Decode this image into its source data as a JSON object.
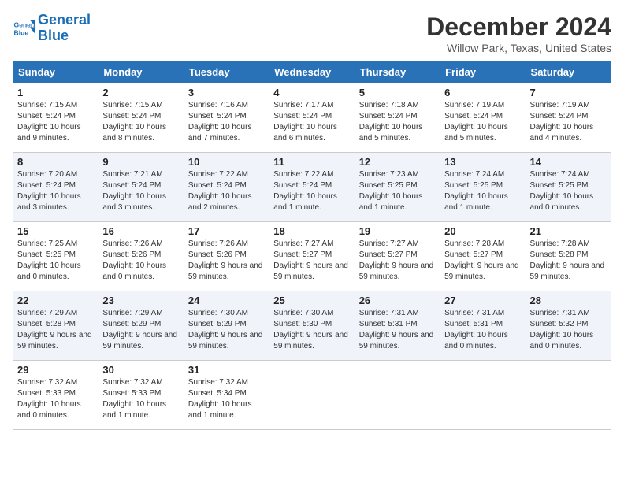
{
  "header": {
    "logo_line1": "General",
    "logo_line2": "Blue",
    "month_title": "December 2024",
    "location": "Willow Park, Texas, United States"
  },
  "weekdays": [
    "Sunday",
    "Monday",
    "Tuesday",
    "Wednesday",
    "Thursday",
    "Friday",
    "Saturday"
  ],
  "weeks": [
    [
      {
        "day": "1",
        "sunrise": "7:15 AM",
        "sunset": "5:24 PM",
        "daylight": "10 hours and 9 minutes."
      },
      {
        "day": "2",
        "sunrise": "7:15 AM",
        "sunset": "5:24 PM",
        "daylight": "10 hours and 8 minutes."
      },
      {
        "day": "3",
        "sunrise": "7:16 AM",
        "sunset": "5:24 PM",
        "daylight": "10 hours and 7 minutes."
      },
      {
        "day": "4",
        "sunrise": "7:17 AM",
        "sunset": "5:24 PM",
        "daylight": "10 hours and 6 minutes."
      },
      {
        "day": "5",
        "sunrise": "7:18 AM",
        "sunset": "5:24 PM",
        "daylight": "10 hours and 5 minutes."
      },
      {
        "day": "6",
        "sunrise": "7:19 AM",
        "sunset": "5:24 PM",
        "daylight": "10 hours and 5 minutes."
      },
      {
        "day": "7",
        "sunrise": "7:19 AM",
        "sunset": "5:24 PM",
        "daylight": "10 hours and 4 minutes."
      }
    ],
    [
      {
        "day": "8",
        "sunrise": "7:20 AM",
        "sunset": "5:24 PM",
        "daylight": "10 hours and 3 minutes."
      },
      {
        "day": "9",
        "sunrise": "7:21 AM",
        "sunset": "5:24 PM",
        "daylight": "10 hours and 3 minutes."
      },
      {
        "day": "10",
        "sunrise": "7:22 AM",
        "sunset": "5:24 PM",
        "daylight": "10 hours and 2 minutes."
      },
      {
        "day": "11",
        "sunrise": "7:22 AM",
        "sunset": "5:24 PM",
        "daylight": "10 hours and 1 minute."
      },
      {
        "day": "12",
        "sunrise": "7:23 AM",
        "sunset": "5:25 PM",
        "daylight": "10 hours and 1 minute."
      },
      {
        "day": "13",
        "sunrise": "7:24 AM",
        "sunset": "5:25 PM",
        "daylight": "10 hours and 1 minute."
      },
      {
        "day": "14",
        "sunrise": "7:24 AM",
        "sunset": "5:25 PM",
        "daylight": "10 hours and 0 minutes."
      }
    ],
    [
      {
        "day": "15",
        "sunrise": "7:25 AM",
        "sunset": "5:25 PM",
        "daylight": "10 hours and 0 minutes."
      },
      {
        "day": "16",
        "sunrise": "7:26 AM",
        "sunset": "5:26 PM",
        "daylight": "10 hours and 0 minutes."
      },
      {
        "day": "17",
        "sunrise": "7:26 AM",
        "sunset": "5:26 PM",
        "daylight": "9 hours and 59 minutes."
      },
      {
        "day": "18",
        "sunrise": "7:27 AM",
        "sunset": "5:27 PM",
        "daylight": "9 hours and 59 minutes."
      },
      {
        "day": "19",
        "sunrise": "7:27 AM",
        "sunset": "5:27 PM",
        "daylight": "9 hours and 59 minutes."
      },
      {
        "day": "20",
        "sunrise": "7:28 AM",
        "sunset": "5:27 PM",
        "daylight": "9 hours and 59 minutes."
      },
      {
        "day": "21",
        "sunrise": "7:28 AM",
        "sunset": "5:28 PM",
        "daylight": "9 hours and 59 minutes."
      }
    ],
    [
      {
        "day": "22",
        "sunrise": "7:29 AM",
        "sunset": "5:28 PM",
        "daylight": "9 hours and 59 minutes."
      },
      {
        "day": "23",
        "sunrise": "7:29 AM",
        "sunset": "5:29 PM",
        "daylight": "9 hours and 59 minutes."
      },
      {
        "day": "24",
        "sunrise": "7:30 AM",
        "sunset": "5:29 PM",
        "daylight": "9 hours and 59 minutes."
      },
      {
        "day": "25",
        "sunrise": "7:30 AM",
        "sunset": "5:30 PM",
        "daylight": "9 hours and 59 minutes."
      },
      {
        "day": "26",
        "sunrise": "7:31 AM",
        "sunset": "5:31 PM",
        "daylight": "9 hours and 59 minutes."
      },
      {
        "day": "27",
        "sunrise": "7:31 AM",
        "sunset": "5:31 PM",
        "daylight": "10 hours and 0 minutes."
      },
      {
        "day": "28",
        "sunrise": "7:31 AM",
        "sunset": "5:32 PM",
        "daylight": "10 hours and 0 minutes."
      }
    ],
    [
      {
        "day": "29",
        "sunrise": "7:32 AM",
        "sunset": "5:33 PM",
        "daylight": "10 hours and 0 minutes."
      },
      {
        "day": "30",
        "sunrise": "7:32 AM",
        "sunset": "5:33 PM",
        "daylight": "10 hours and 1 minute."
      },
      {
        "day": "31",
        "sunrise": "7:32 AM",
        "sunset": "5:34 PM",
        "daylight": "10 hours and 1 minute."
      },
      null,
      null,
      null,
      null
    ]
  ]
}
